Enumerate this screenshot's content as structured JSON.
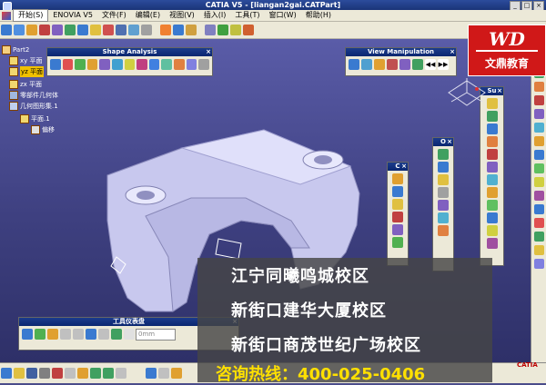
{
  "window": {
    "title": "CATIA V5 - [liangan2gai.CATPart]",
    "buttons": [
      "_",
      "□",
      "×"
    ]
  },
  "menu": [
    "开始(S)",
    "ENOVIA V5",
    "文件(F)",
    "编辑(E)",
    "视图(V)",
    "插入(I)",
    "工具(T)",
    "窗口(W)",
    "帮助(H)"
  ],
  "tree": {
    "root": "Part2",
    "items": [
      "xy 平面",
      "yz 平面",
      "zx 平面",
      "零部件几何体",
      "几何图形集.1",
      "平面.1",
      "偏移"
    ]
  },
  "panels": {
    "shape_analysis": "Shape Analysis",
    "view_manipulation": "View Manipulation",
    "tools": "工具仪表盘",
    "su": "Su",
    "o": "O",
    "c": "C"
  },
  "tools_value": "0mm",
  "logo": {
    "mark": "WD",
    "text": "文鼎教育"
  },
  "ad": {
    "lines": [
      "江宁同曦鸣城校区",
      "新街口建华大厦校区",
      "新街口商茂世纪广场校区"
    ],
    "hotline": "咨询热线：400-025-0406"
  },
  "brand": "CATIA",
  "colors": {
    "accent": "#1c3c8c",
    "menu_bg": "#ece9d8",
    "viewport_top": "#5a5ca8",
    "logo_red": "#d01818",
    "hotline": "#ffe000"
  }
}
